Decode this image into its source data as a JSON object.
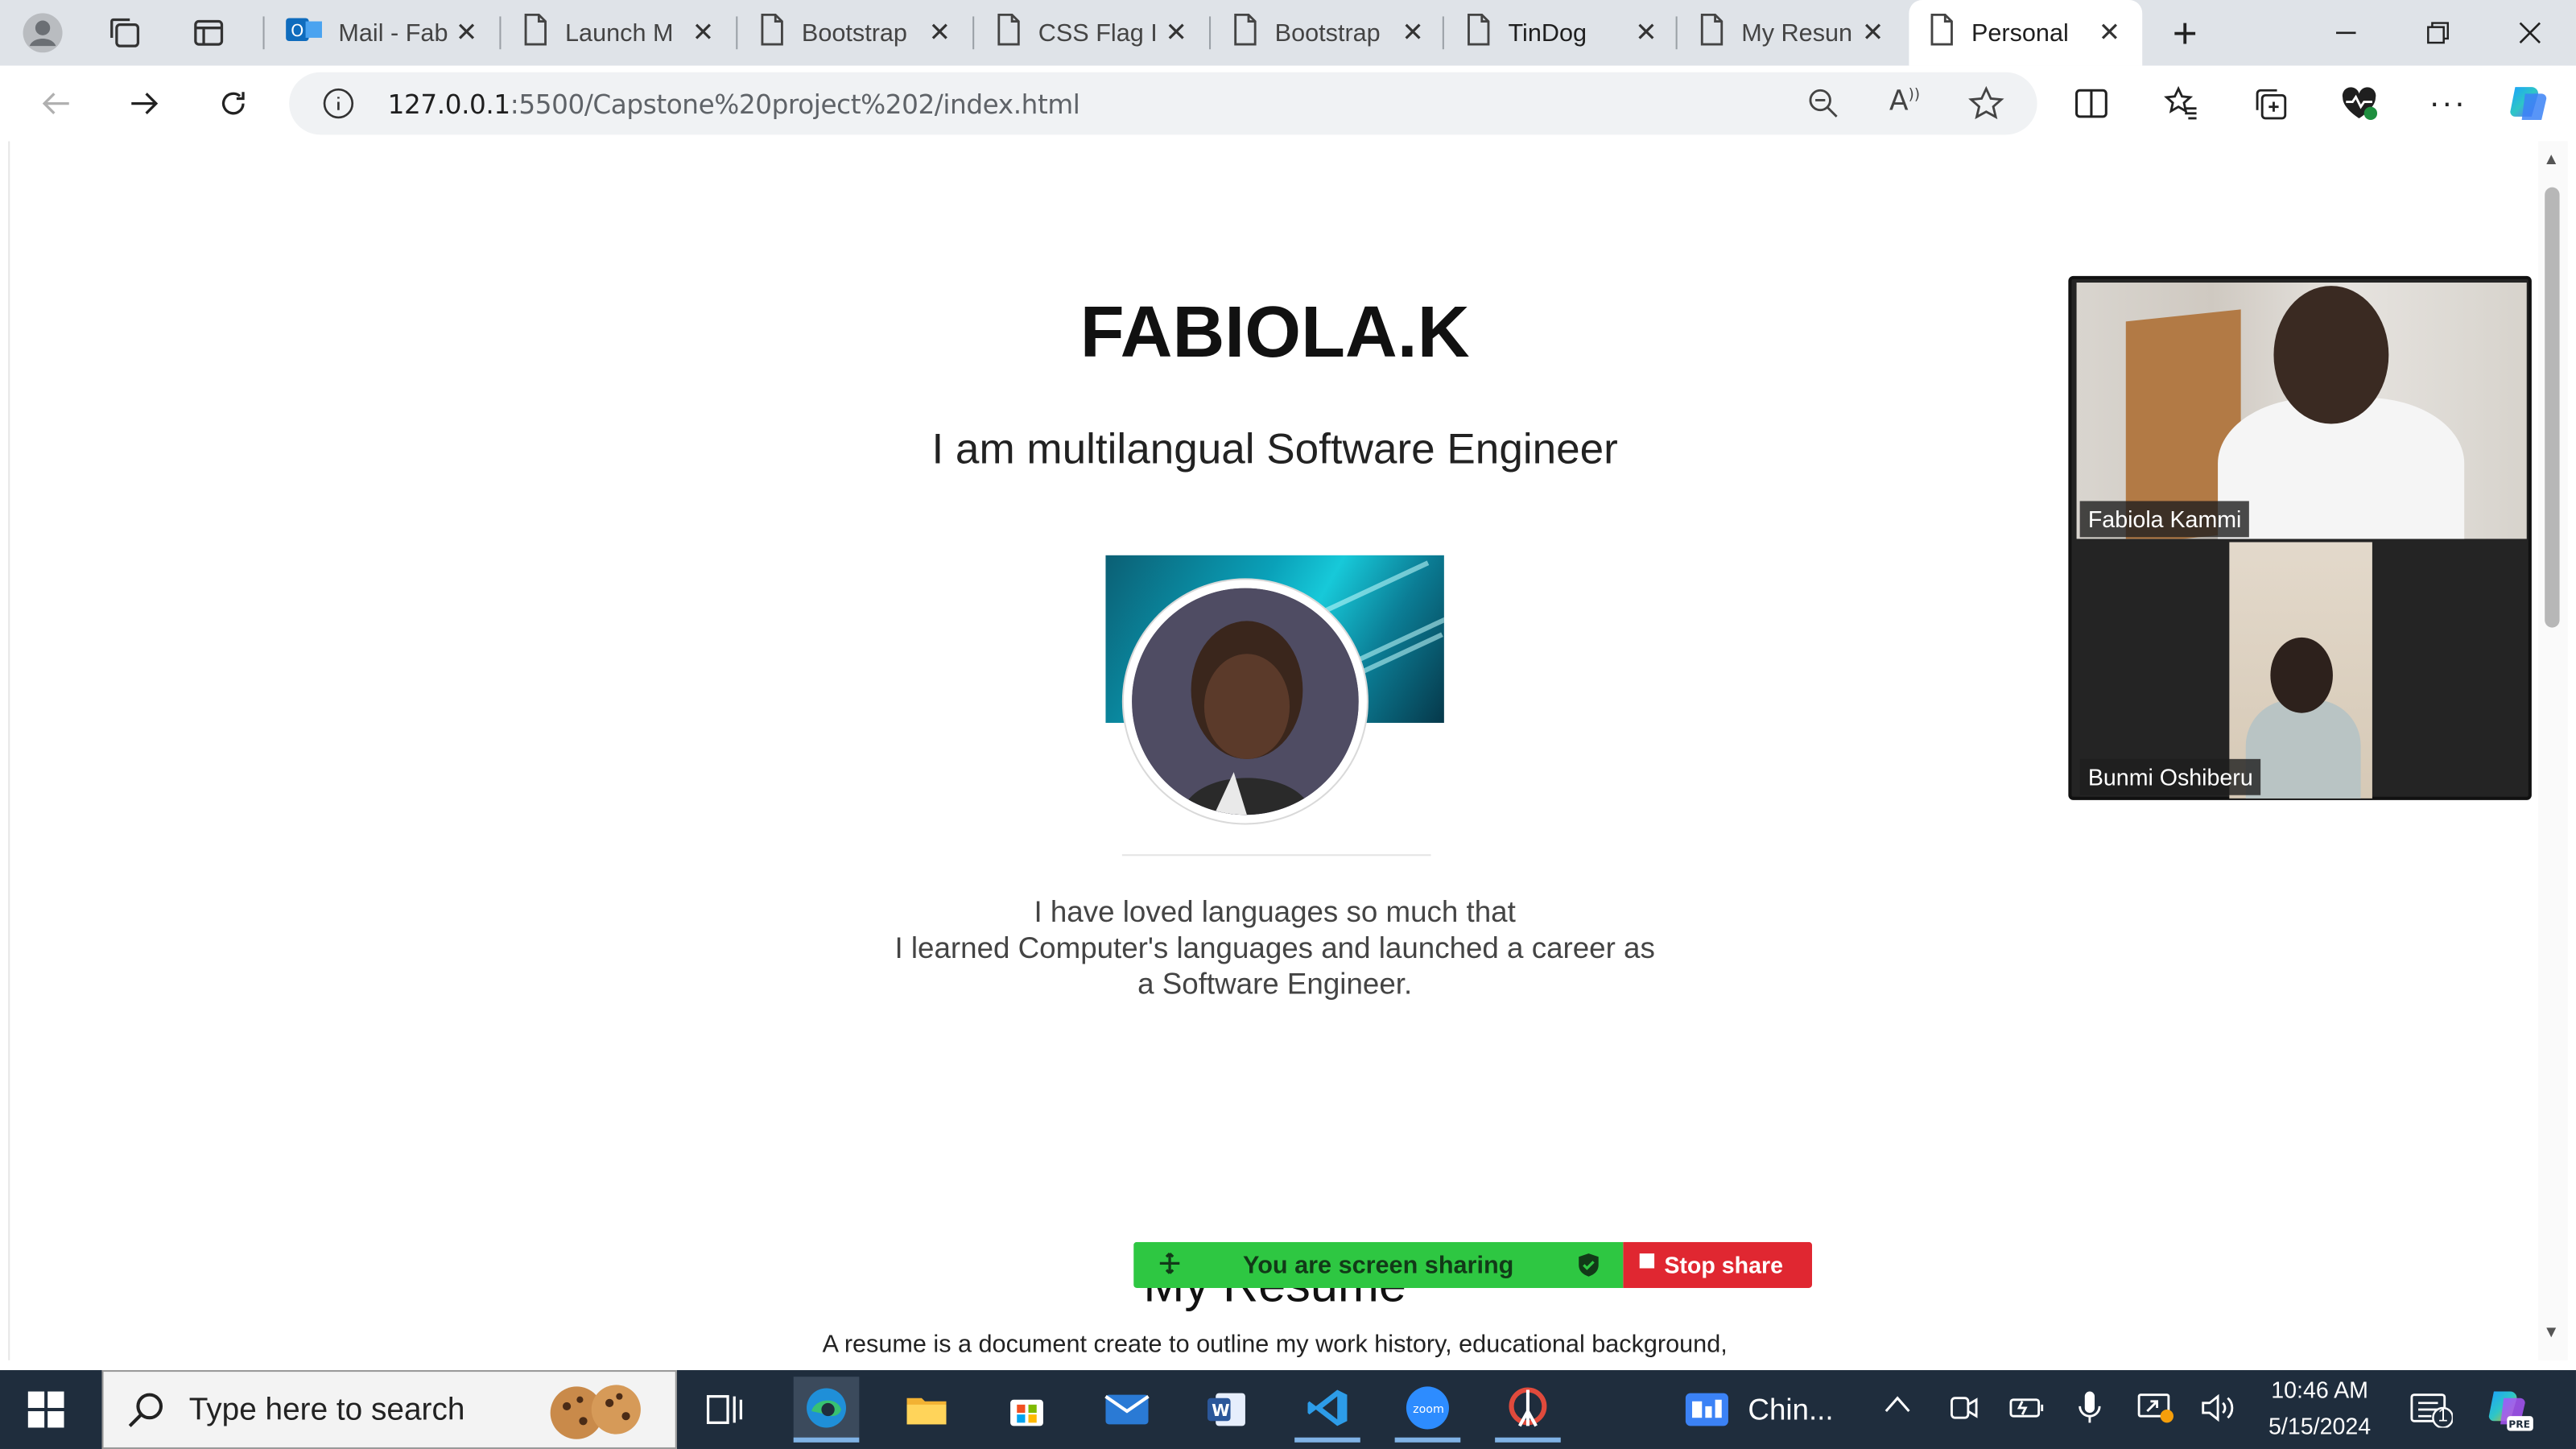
{
  "browser": {
    "tabs": [
      {
        "title": "Mail - Fab",
        "icon": "outlook-icon"
      },
      {
        "title": "Launch M",
        "icon": "page-icon"
      },
      {
        "title": "Bootstrap",
        "icon": "page-icon"
      },
      {
        "title": "CSS Flag I",
        "icon": "page-icon"
      },
      {
        "title": "Bootstrap",
        "icon": "page-icon"
      },
      {
        "title": "TinDog",
        "icon": "page-icon"
      },
      {
        "title": "My Resun",
        "icon": "page-icon"
      },
      {
        "title": "Personal",
        "icon": "page-icon",
        "active": true
      }
    ],
    "url_host": "127.0.0.1",
    "url_rest": ":5500/Capstone%20project%202/index.html"
  },
  "page": {
    "title": "FABIOLA.K",
    "subtitle": "I am multilangual Software Engineer",
    "intro_lines": [
      "I have loved languages so much that",
      "I learned Computer's languages and launched a career as",
      "a Software Engineer."
    ],
    "resume_heading": "My Resume",
    "resume_text": "A resume is a document create to outline my work history, educational background,"
  },
  "share_bar": {
    "status": "You are screen sharing",
    "stop_label": "Stop share"
  },
  "video": {
    "participant_1": "Fabiola Kammi",
    "participant_2": "Bunmi Oshiberu"
  },
  "taskbar": {
    "search_placeholder": "Type here to search",
    "weather": "Chin...",
    "time": "10:46 AM",
    "date": "5/15/2024",
    "notifications": "1"
  },
  "colors": {
    "share_green": "#2ec742",
    "share_red": "#e02731",
    "taskbar": "#1f2d3d"
  }
}
